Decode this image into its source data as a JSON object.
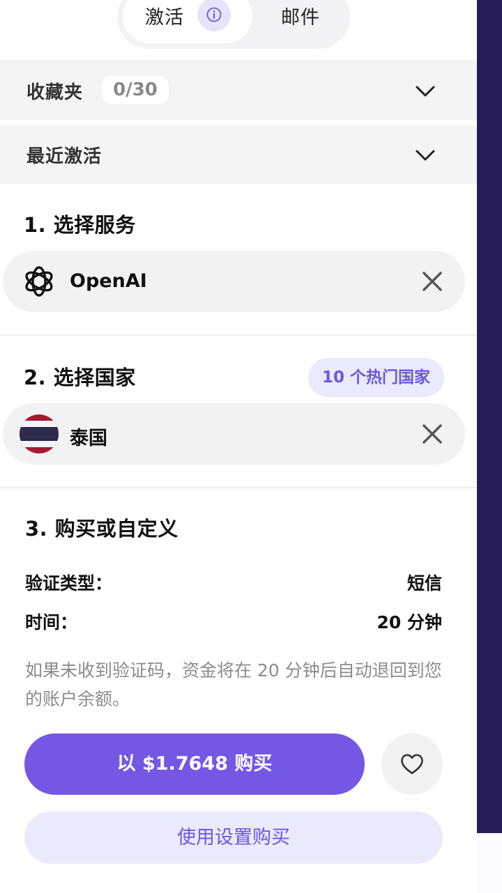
{
  "tabs": [
    {
      "label": "激活",
      "active": true,
      "info_icon": "info-icon"
    },
    {
      "label": "邮件",
      "active": false
    }
  ],
  "favorites": {
    "label": "收藏夹",
    "count": "0/30",
    "icon": "chevron-down-icon"
  },
  "recent": {
    "label": "最近激活",
    "icon": "chevron-down-icon"
  },
  "step1": {
    "title": "1. 选择服务",
    "selected": "OpenAI",
    "icon": "openai-logo-icon",
    "clear_icon": "close-icon"
  },
  "step2": {
    "title": "2. 选择国家",
    "popular_label": "10 个热门国家",
    "selected": "泰国",
    "icon": "thailand-flag-icon",
    "clear_icon": "close-icon"
  },
  "step3": {
    "title": "3. 购买或自定义",
    "verify_label": "验证类型：",
    "verify_value": "短信",
    "time_label": "时间：",
    "time_value": "20 分钟",
    "note": "如果未收到验证码，资金将在 20 分钟后自动退回到您的账户余额。",
    "buy_label": "以 $1.7648 购买",
    "favorite_icon": "heart-icon",
    "settings_label": "使用设置购买"
  },
  "colors": {
    "accent": "#7457e4",
    "accent_light": "#ebe9fc",
    "sidebar": "#261d57",
    "row_bg": "#f4f4f5"
  }
}
